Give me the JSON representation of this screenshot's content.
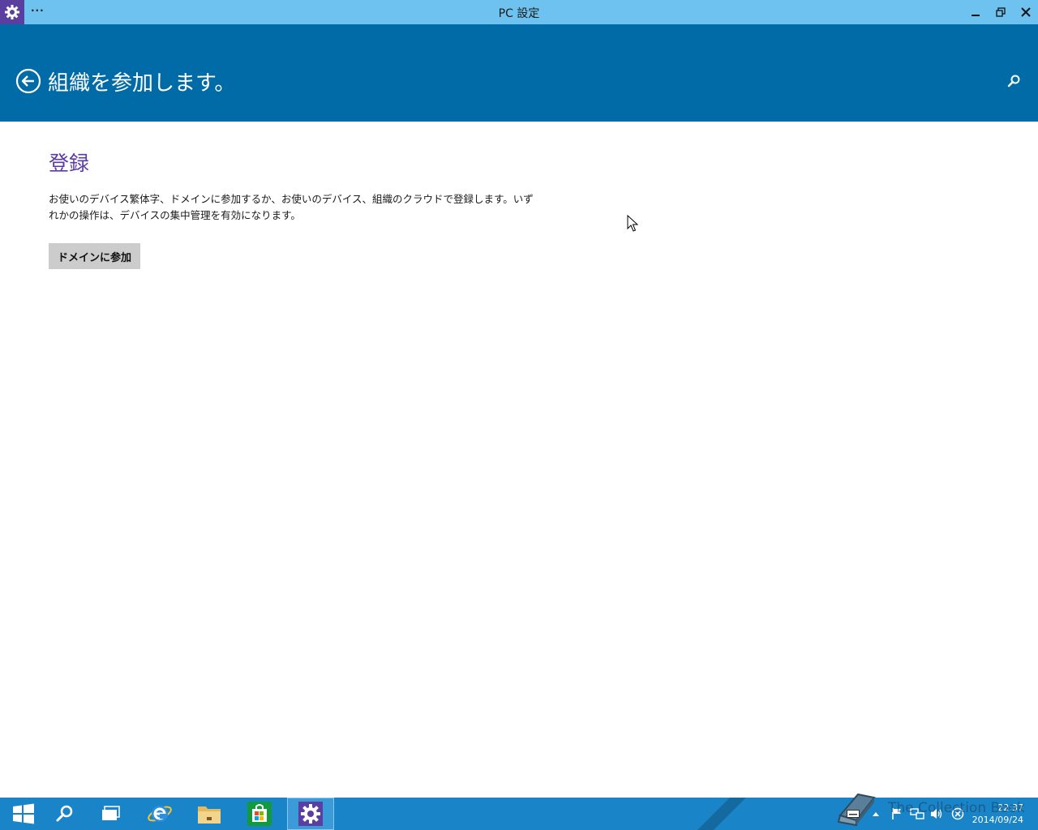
{
  "titlebar": {
    "title": "PC 設定",
    "menu_label": "···",
    "app_icon": "gear-icon",
    "controls": [
      "minimize-icon",
      "restore-icon",
      "close-icon"
    ]
  },
  "header": {
    "title": "組織を参加します。",
    "back_icon": "back-arrow-icon",
    "search_icon": "search-icon"
  },
  "content": {
    "section_title": "登録",
    "description": "お使いのデバイス繁体字、ドメインに参加するか、お使いのデバイス、組織のクラウドで登録します。いずれかの操作は、デバイスの集中管理を有効になります。",
    "join_button_label": "ドメインに参加"
  },
  "taskbar": {
    "items": [
      "start-icon",
      "search-icon",
      "task-view-icon",
      "internet-explorer-icon",
      "file-explorer-icon",
      "store-icon",
      "pc-settings-icon"
    ],
    "active_item": "pc-settings-icon",
    "tray_icons": [
      "keyboard-icon",
      "show-hidden-icons-icon",
      "action-center-flag-icon",
      "network-icon",
      "volume-icon",
      "error-icon"
    ],
    "time": "22:37",
    "date": "2014/09/24"
  },
  "watermark": "The Collection Book",
  "colors": {
    "titlebar": "#6dc2ef",
    "header": "#006ba6",
    "accent_purple": "#5b3aa8",
    "taskbar": "#1a84c8",
    "button": "#cccccc"
  }
}
